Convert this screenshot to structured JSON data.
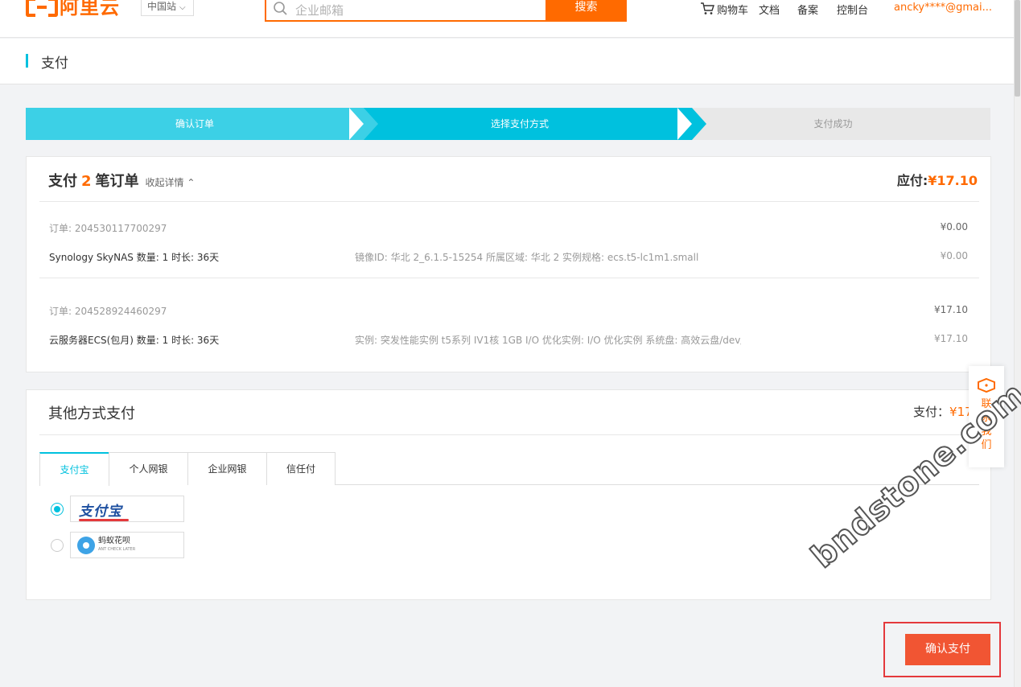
{
  "header": {
    "logo_text": "阿里云",
    "region": "中国站",
    "search_placeholder": "企业邮箱",
    "search_button": "搜索",
    "nav": {
      "cart": "购物车",
      "docs": "文档",
      "beian": "备案",
      "console": "控制台"
    },
    "user": "ancky****@gmai..."
  },
  "page_title": "支付",
  "steps": [
    "确认订单",
    "选择支付方式",
    "支付成功"
  ],
  "orders": {
    "title_prefix": "支付",
    "count": "2",
    "title_suffix": "笔订单",
    "toggle": "收起详情",
    "due_label": "应付:",
    "due_amount": "¥17.10",
    "items": [
      {
        "order_id": "订单: 204530117700297",
        "order_price": "¥0.00",
        "product": "Synology SkyNAS 数量: 1 时长: 36天",
        "details": "镜像ID: 华北 2_6.1.5-15254 所属区域: 华北 2 实例规格: ecs.t5-lc1m1.small",
        "price": "¥0.00"
      },
      {
        "order_id": "订单: 204528924460297",
        "order_price": "¥17.10",
        "product": "云服务器ECS(包月) 数量: 1 时长: 36天",
        "details": "实例: 突发性能实例 t5系列 IV1核 1GB I/O 优化实例: I/O 优化实例 系统盘: 高效云盘/dev/xv",
        "price": "¥17.10"
      }
    ]
  },
  "other_payment": {
    "title": "其他方式支付",
    "pay_label": "支付：",
    "pay_amount": "¥17.1",
    "tabs": [
      "支付宝",
      "个人网银",
      "企业网银",
      "信任付"
    ],
    "options": [
      {
        "name": "支付宝",
        "selected": true
      },
      {
        "name": "蚂蚁花呗",
        "subtitle": "ANT CHECK LATER",
        "selected": false
      }
    ]
  },
  "contact": {
    "label": "联系我们"
  },
  "confirm_button": "确认支付",
  "watermark": "bndstone.com",
  "colors": {
    "brand": "#ff6a00",
    "accent": "#00c1de",
    "confirm": "#f15533"
  }
}
